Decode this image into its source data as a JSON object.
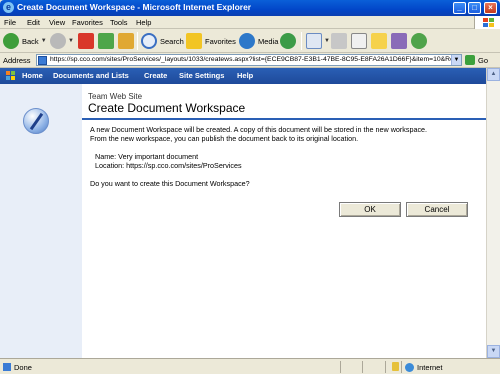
{
  "window": {
    "title": "Create Document Workspace - Microsoft Internet Explorer"
  },
  "menu": [
    "File",
    "Edit",
    "View",
    "Favorites",
    "Tools",
    "Help"
  ],
  "toolbar": {
    "back_label": "Back",
    "search_label": "Search",
    "favorites_label": "Favorites",
    "media_label": "Media"
  },
  "address": {
    "label": "Address",
    "url": "https://sp.cco.com/sites/ProServices/_layouts/1033/createws.aspx?list={ECE9CB87-E3B1-47BE-8C95-E8FA26A1D66F}&item=10&Ro",
    "go_label": "Go"
  },
  "spnav": {
    "items": [
      "Home",
      "Documents and Lists",
      "Create",
      "Site Settings",
      "Help"
    ]
  },
  "page": {
    "site_name": "Team Web Site",
    "title": "Create Document Workspace",
    "intro_line1": "A new Document Workspace will be created. A copy of this document will be stored in the new workspace.",
    "intro_line2": "From the new workspace, you can publish the document back to its original location.",
    "name_line": "Name: Very important document",
    "location_line": "Location: https://sp.cco.com/sites/ProServices",
    "question": "Do you want to create this Document Workspace?",
    "ok_label": "OK",
    "cancel_label": "Cancel"
  },
  "status": {
    "text": "Done",
    "zone": "Internet"
  },
  "colors": {
    "sp_nav": "#2a5fb5",
    "left_panel": "#e8eef8",
    "title_bar": "#0246c8"
  }
}
